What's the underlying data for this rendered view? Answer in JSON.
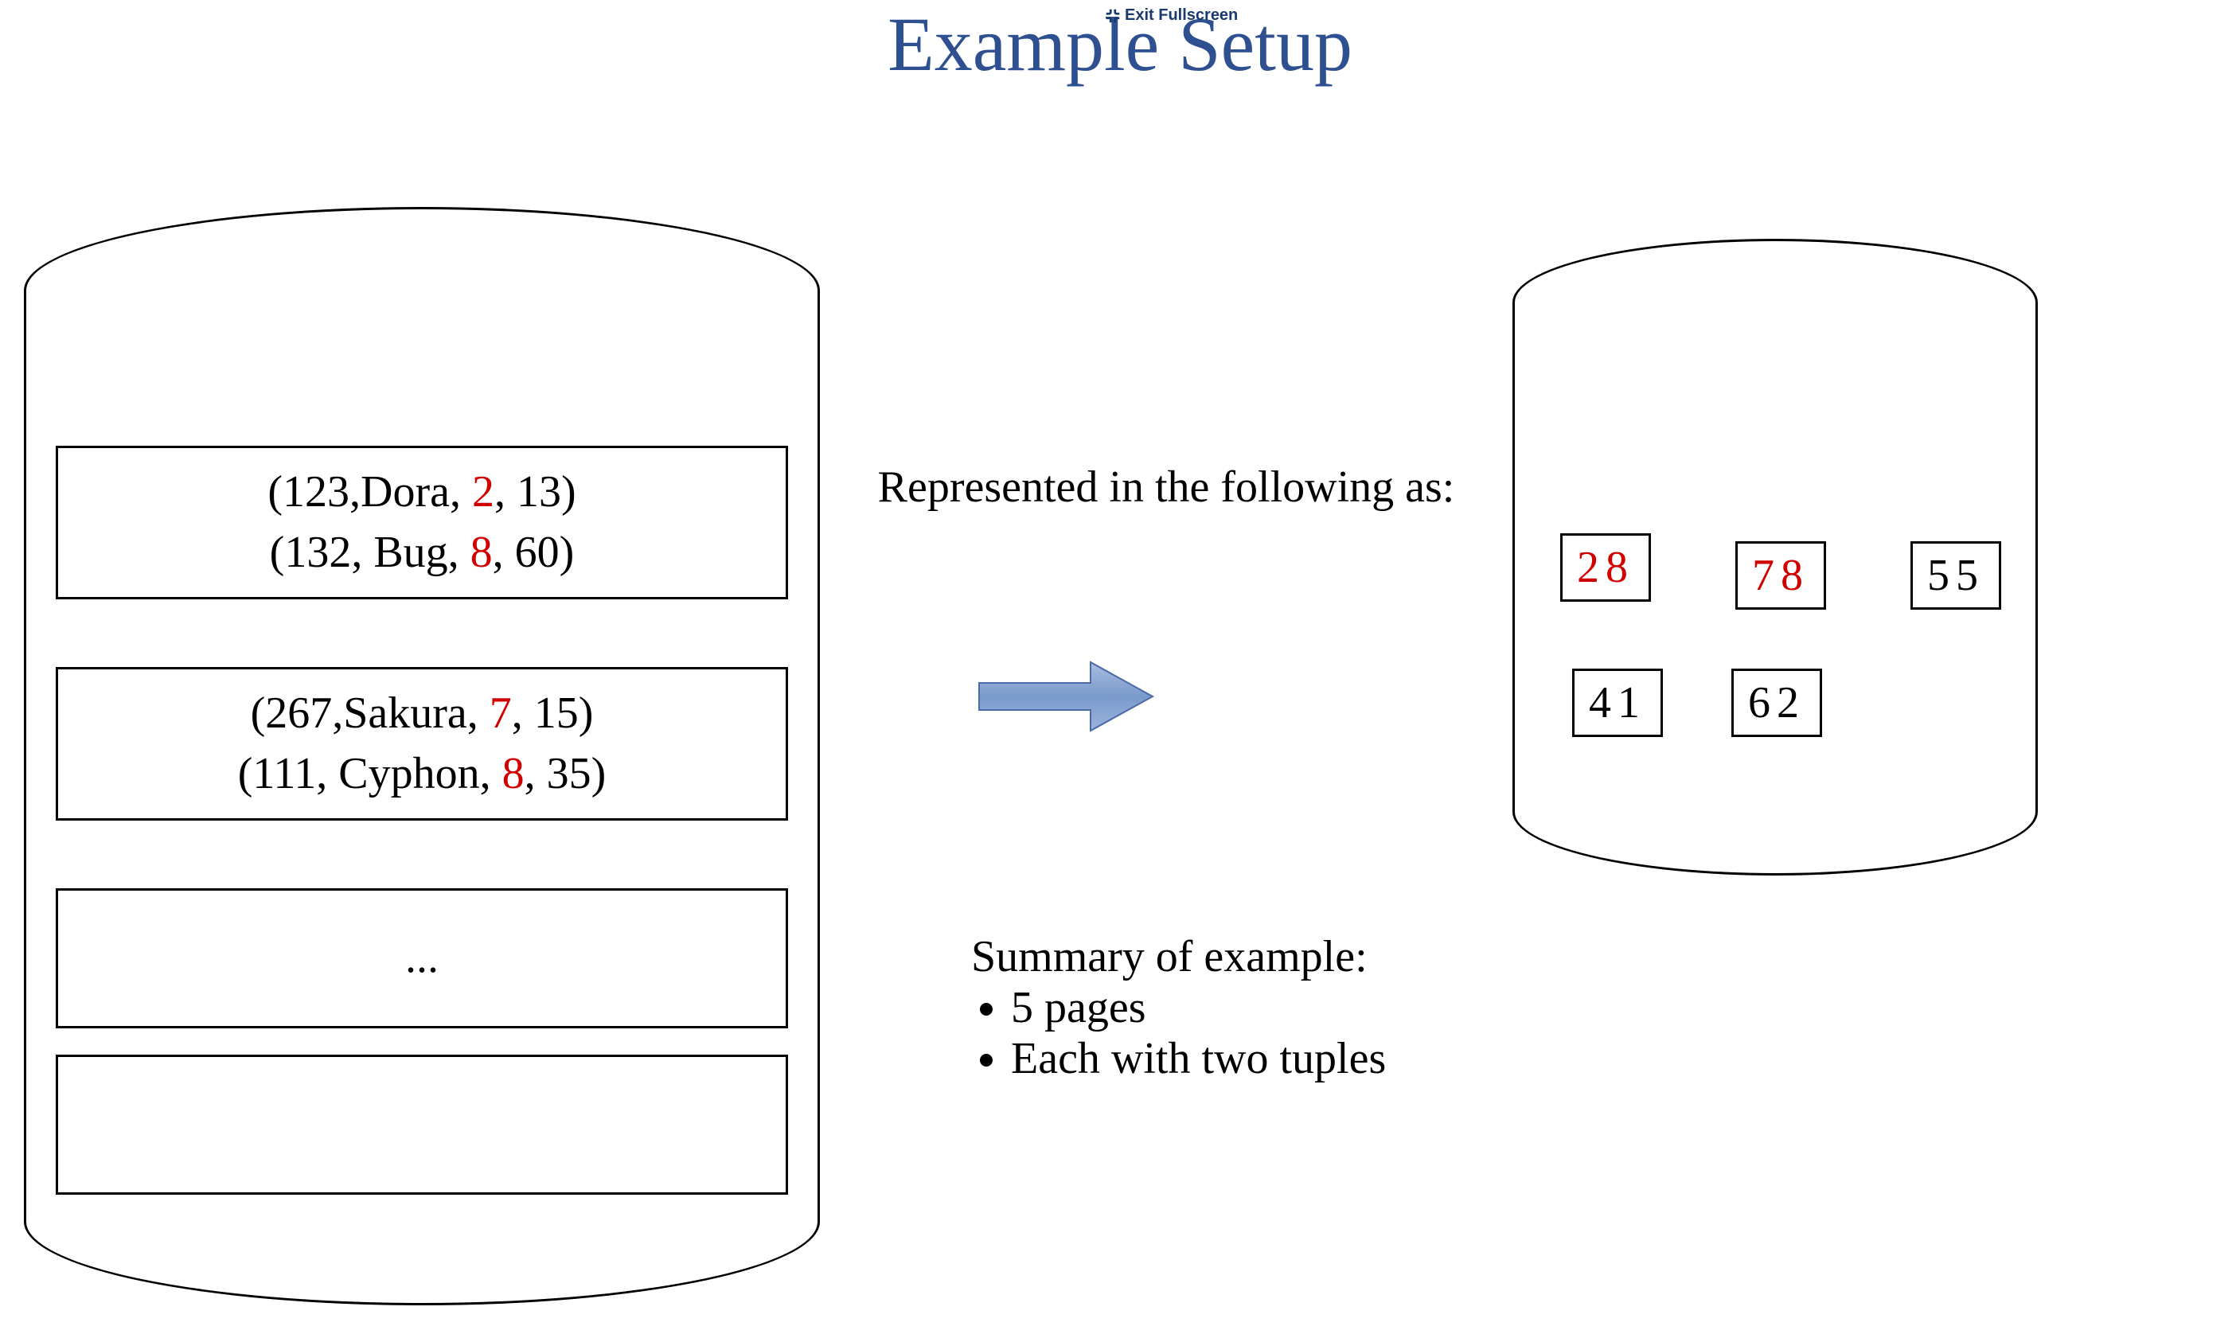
{
  "title": "Example Setup",
  "exitFullscreen": "Exit Fullscreen",
  "caption": "Represented in the following as:",
  "summary": {
    "heading": "Summary of example:",
    "items": [
      "5 pages",
      "Each with two tuples"
    ]
  },
  "leftRecords": {
    "box1": {
      "pre1a": "(123,Dora, ",
      "hi1a": "2",
      "post1a": ", 13)",
      "pre1b": "(132, Bug, ",
      "hi1b": "8",
      "post1b": ", 60)"
    },
    "box2": {
      "pre2a": "(267,Sakura, ",
      "hi2a": "7",
      "post2a": ", 15)",
      "pre2b": "(111, Cyphon, ",
      "hi2b": "8",
      "post2b": ", 35)"
    },
    "ellipsis": "..."
  },
  "smallBoxes": {
    "b1": "28",
    "b2": "78",
    "b3": "55",
    "b4": "41",
    "b5": "62"
  },
  "colors": {
    "titleColor": "#2e5090",
    "highlightColor": "#d00000",
    "arrowFill": "#8ba8d8",
    "arrowStroke": "#4a6aa8"
  }
}
